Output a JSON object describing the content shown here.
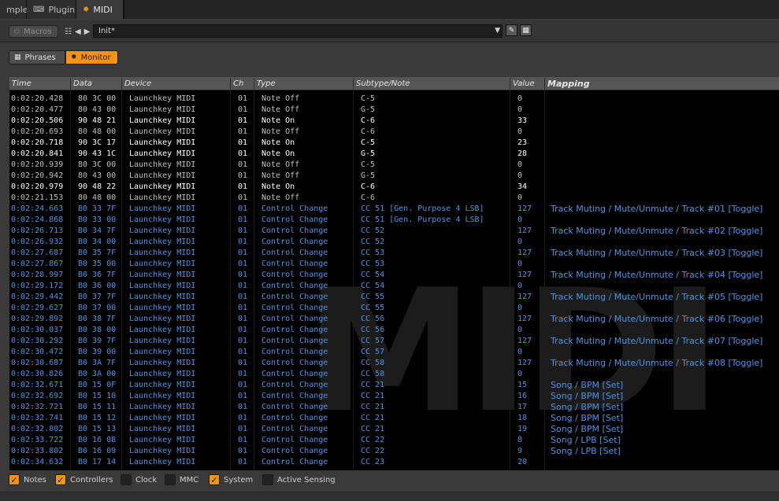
{
  "tabs": [
    {
      "label": "mpler",
      "icon": ""
    },
    {
      "label": "Plugin",
      "icon": "plug-icon"
    },
    {
      "label": "MIDI",
      "icon": "midi-port-icon"
    }
  ],
  "toolbar": {
    "macros_label": "Macros",
    "preset_name": "Init*"
  },
  "modes": {
    "phrases_label": "Phrases",
    "monitor_label": "Monitor"
  },
  "columns": {
    "time": "Time",
    "data": "Data",
    "device": "Device",
    "ch": "Ch",
    "type": "Type",
    "subtype": "Subtype/Note",
    "value": "Value",
    "mapping": "Mapping"
  },
  "watermark": "MIDI",
  "rows": [
    {
      "time": "0:02:20.428",
      "data": "80 3C 00",
      "device": "Launchkey MIDI",
      "ch": "01",
      "type": "Note Off",
      "sub": "C-5",
      "value": "0",
      "mapping": "",
      "kind": "off"
    },
    {
      "time": "0:02:20.477",
      "data": "80 43 00",
      "device": "Launchkey MIDI",
      "ch": "01",
      "type": "Note Off",
      "sub": "G-5",
      "value": "0",
      "mapping": "",
      "kind": "off"
    },
    {
      "time": "0:02:20.506",
      "data": "90 48 21",
      "device": "Launchkey MIDI",
      "ch": "01",
      "type": "Note On",
      "sub": "C-6",
      "value": "33",
      "mapping": "",
      "kind": "on"
    },
    {
      "time": "0:02:20.693",
      "data": "80 48 00",
      "device": "Launchkey MIDI",
      "ch": "01",
      "type": "Note Off",
      "sub": "C-6",
      "value": "0",
      "mapping": "",
      "kind": "off"
    },
    {
      "time": "0:02:20.718",
      "data": "90 3C 17",
      "device": "Launchkey MIDI",
      "ch": "01",
      "type": "Note On",
      "sub": "C-5",
      "value": "23",
      "mapping": "",
      "kind": "on"
    },
    {
      "time": "0:02:20.841",
      "data": "90 43 1C",
      "device": "Launchkey MIDI",
      "ch": "01",
      "type": "Note On",
      "sub": "G-5",
      "value": "28",
      "mapping": "",
      "kind": "on"
    },
    {
      "time": "0:02:20.939",
      "data": "80 3C 00",
      "device": "Launchkey MIDI",
      "ch": "01",
      "type": "Note Off",
      "sub": "C-5",
      "value": "0",
      "mapping": "",
      "kind": "off"
    },
    {
      "time": "0:02:20.942",
      "data": "80 43 00",
      "device": "Launchkey MIDI",
      "ch": "01",
      "type": "Note Off",
      "sub": "G-5",
      "value": "0",
      "mapping": "",
      "kind": "off"
    },
    {
      "time": "0:02:20.979",
      "data": "90 48 22",
      "device": "Launchkey MIDI",
      "ch": "01",
      "type": "Note On",
      "sub": "C-6",
      "value": "34",
      "mapping": "",
      "kind": "on"
    },
    {
      "time": "0:02:21.153",
      "data": "80 48 00",
      "device": "Launchkey MIDI",
      "ch": "01",
      "type": "Note Off",
      "sub": "C-6",
      "value": "0",
      "mapping": "",
      "kind": "off"
    },
    {
      "time": "0:02:24.663",
      "data": "B0 33 7F",
      "device": "Launchkey MIDI",
      "ch": "01",
      "type": "Control Change",
      "sub": "CC 51 [Gen. Purpose 4 LSB]",
      "value": "127",
      "mapping": "Track Muting / Mute/Unmute / Track #01 [Toggle]",
      "kind": "cc"
    },
    {
      "time": "0:02:24.868",
      "data": "B0 33 00",
      "device": "Launchkey MIDI",
      "ch": "01",
      "type": "Control Change",
      "sub": "CC 51 [Gen. Purpose 4 LSB]",
      "value": "0",
      "mapping": "",
      "kind": "cc"
    },
    {
      "time": "0:02:26.713",
      "data": "B0 34 7F",
      "device": "Launchkey MIDI",
      "ch": "01",
      "type": "Control Change",
      "sub": "CC 52",
      "value": "127",
      "mapping": "Track Muting / Mute/Unmute / Track #02 [Toggle]",
      "kind": "cc"
    },
    {
      "time": "0:02:26.932",
      "data": "B0 34 00",
      "device": "Launchkey MIDI",
      "ch": "01",
      "type": "Control Change",
      "sub": "CC 52",
      "value": "0",
      "mapping": "",
      "kind": "cc"
    },
    {
      "time": "0:02:27.687",
      "data": "B0 35 7F",
      "device": "Launchkey MIDI",
      "ch": "01",
      "type": "Control Change",
      "sub": "CC 53",
      "value": "127",
      "mapping": "Track Muting / Mute/Unmute / Track #03 [Toggle]",
      "kind": "cc"
    },
    {
      "time": "0:02:27.867",
      "data": "B0 35 00",
      "device": "Launchkey MIDI",
      "ch": "01",
      "type": "Control Change",
      "sub": "CC 53",
      "value": "0",
      "mapping": "",
      "kind": "cc"
    },
    {
      "time": "0:02:28.997",
      "data": "B0 36 7F",
      "device": "Launchkey MIDI",
      "ch": "01",
      "type": "Control Change",
      "sub": "CC 54",
      "value": "127",
      "mapping": "Track Muting / Mute/Unmute / Track #04 [Toggle]",
      "kind": "cc"
    },
    {
      "time": "0:02:29.172",
      "data": "B0 36 00",
      "device": "Launchkey MIDI",
      "ch": "01",
      "type": "Control Change",
      "sub": "CC 54",
      "value": "0",
      "mapping": "",
      "kind": "cc"
    },
    {
      "time": "0:02:29.442",
      "data": "B0 37 7F",
      "device": "Launchkey MIDI",
      "ch": "01",
      "type": "Control Change",
      "sub": "CC 55",
      "value": "127",
      "mapping": "Track Muting / Mute/Unmute / Track #05 [Toggle]",
      "kind": "cc"
    },
    {
      "time": "0:02:29.627",
      "data": "B0 37 00",
      "device": "Launchkey MIDI",
      "ch": "01",
      "type": "Control Change",
      "sub": "CC 55",
      "value": "0",
      "mapping": "",
      "kind": "cc"
    },
    {
      "time": "0:02:29.892",
      "data": "B0 38 7F",
      "device": "Launchkey MIDI",
      "ch": "01",
      "type": "Control Change",
      "sub": "CC 56",
      "value": "127",
      "mapping": "Track Muting / Mute/Unmute / Track #06 [Toggle]",
      "kind": "cc"
    },
    {
      "time": "0:02:30.037",
      "data": "B0 38 00",
      "device": "Launchkey MIDI",
      "ch": "01",
      "type": "Control Change",
      "sub": "CC 56",
      "value": "0",
      "mapping": "",
      "kind": "cc"
    },
    {
      "time": "0:02:30.292",
      "data": "B0 39 7F",
      "device": "Launchkey MIDI",
      "ch": "01",
      "type": "Control Change",
      "sub": "CC 57",
      "value": "127",
      "mapping": "Track Muting / Mute/Unmute / Track #07 [Toggle]",
      "kind": "cc"
    },
    {
      "time": "0:02:30.472",
      "data": "B0 39 00",
      "device": "Launchkey MIDI",
      "ch": "01",
      "type": "Control Change",
      "sub": "CC 57",
      "value": "0",
      "mapping": "",
      "kind": "cc"
    },
    {
      "time": "0:02:30.687",
      "data": "B0 3A 7F",
      "device": "Launchkey MIDI",
      "ch": "01",
      "type": "Control Change",
      "sub": "CC 58",
      "value": "127",
      "mapping": "Track Muting / Mute/Unmute / Track #08 [Toggle]",
      "kind": "cc"
    },
    {
      "time": "0:02:30.826",
      "data": "B0 3A 00",
      "device": "Launchkey MIDI",
      "ch": "01",
      "type": "Control Change",
      "sub": "CC 58",
      "value": "0",
      "mapping": "",
      "kind": "cc"
    },
    {
      "time": "0:02:32.671",
      "data": "B0 15 0F",
      "device": "Launchkey MIDI",
      "ch": "01",
      "type": "Control Change",
      "sub": "CC 21",
      "value": "15",
      "mapping": "Song / BPM [Set]",
      "kind": "cc"
    },
    {
      "time": "0:02:32.692",
      "data": "B0 15 10",
      "device": "Launchkey MIDI",
      "ch": "01",
      "type": "Control Change",
      "sub": "CC 21",
      "value": "16",
      "mapping": "Song / BPM [Set]",
      "kind": "cc"
    },
    {
      "time": "0:02:32.721",
      "data": "B0 15 11",
      "device": "Launchkey MIDI",
      "ch": "01",
      "type": "Control Change",
      "sub": "CC 21",
      "value": "17",
      "mapping": "Song / BPM [Set]",
      "kind": "cc"
    },
    {
      "time": "0:02:32.741",
      "data": "B0 15 12",
      "device": "Launchkey MIDI",
      "ch": "01",
      "type": "Control Change",
      "sub": "CC 21",
      "value": "18",
      "mapping": "Song / BPM [Set]",
      "kind": "cc"
    },
    {
      "time": "0:02:32.802",
      "data": "B0 15 13",
      "device": "Launchkey MIDI",
      "ch": "01",
      "type": "Control Change",
      "sub": "CC 21",
      "value": "19",
      "mapping": "Song / BPM [Set]",
      "kind": "cc"
    },
    {
      "time": "0:02:33.722",
      "data": "B0 16 08",
      "device": "Launchkey MIDI",
      "ch": "01",
      "type": "Control Change",
      "sub": "CC 22",
      "value": "8",
      "mapping": "Song / LPB [Set]",
      "kind": "cc"
    },
    {
      "time": "0:02:33.802",
      "data": "B0 16 09",
      "device": "Launchkey MIDI",
      "ch": "01",
      "type": "Control Change",
      "sub": "CC 22",
      "value": "9",
      "mapping": "Song / LPB [Set]",
      "kind": "cc"
    },
    {
      "time": "0:02:34.632",
      "data": "B0 17 14",
      "device": "Launchkey MIDI",
      "ch": "01",
      "type": "Control Change",
      "sub": "CC 23",
      "value": "20",
      "mapping": "",
      "kind": "cc"
    }
  ],
  "filters": [
    {
      "label": "Notes",
      "checked": true
    },
    {
      "label": "Controllers",
      "checked": true
    },
    {
      "label": "Clock",
      "checked": false
    },
    {
      "label": "MMC",
      "checked": false
    },
    {
      "label": "System",
      "checked": true
    },
    {
      "label": "Active Sensing",
      "checked": false
    }
  ],
  "colors": {
    "accent": "#f29318",
    "cc_text": "#4a95e6",
    "note_on": "#ffffff",
    "note_off": "#c0c0c0"
  }
}
